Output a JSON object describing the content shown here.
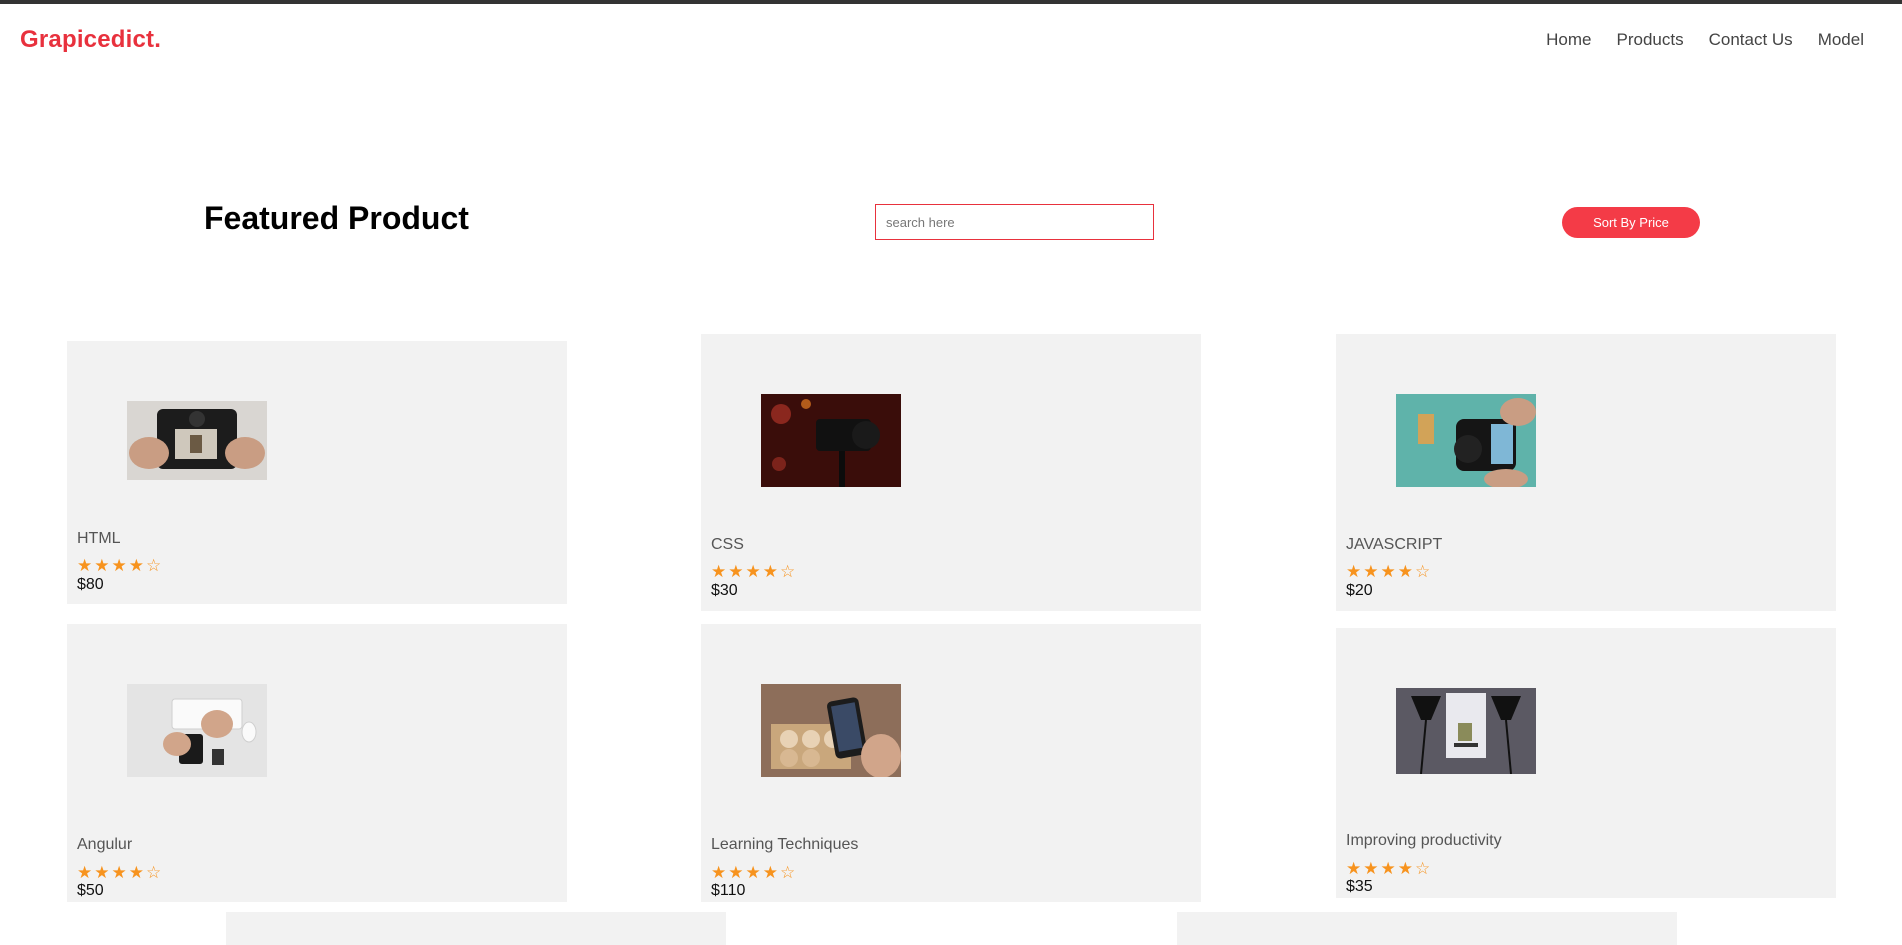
{
  "header": {
    "logo": "Grapicedict.",
    "nav": [
      "Home",
      "Products",
      "Contact Us",
      "Model"
    ]
  },
  "main": {
    "title": "Featured Product",
    "search": {
      "placeholder": "search here",
      "value": ""
    },
    "sort_button": "Sort By Price"
  },
  "rating": {
    "filled": "★★★★",
    "empty": "☆"
  },
  "products": [
    {
      "name": "HTML",
      "price": "$80",
      "rating": 4,
      "image": "camera-back-screen-photo"
    },
    {
      "name": "CSS",
      "price": "$30",
      "rating": 4,
      "image": "video-camera-on-tripod-photo"
    },
    {
      "name": "JAVASCRIPT",
      "price": "$20",
      "rating": 4,
      "image": "camera-in-hands-teal-background-photo"
    },
    {
      "name": "Angulur",
      "price": "$50",
      "rating": 4,
      "image": "keyboard-and-phone-desk-photo"
    },
    {
      "name": "Learning Techniques",
      "price": "$110",
      "rating": 4,
      "image": "phone-photographing-food-photo"
    },
    {
      "name": "Improving productivity",
      "price": "$35",
      "rating": 4,
      "image": "product-photo-studio-lights-photo"
    }
  ],
  "colors": {
    "brand": "#e8313d",
    "button": "#f43b47",
    "star": "#f7931e",
    "card": "#f2f2f2"
  }
}
